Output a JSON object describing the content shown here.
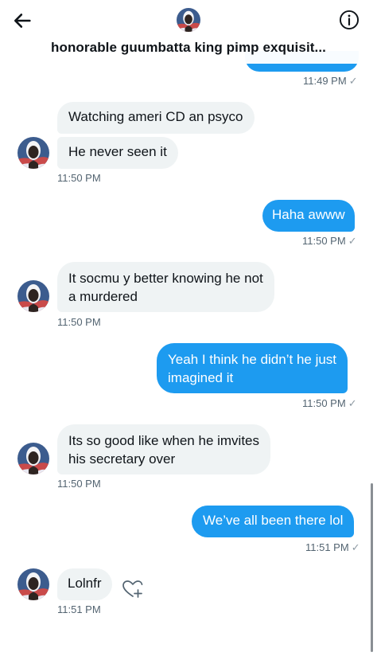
{
  "header": {
    "title": "honorable guumbatta king pimp exquisit...",
    "back_icon": "arrow-left-icon",
    "info_icon": "info-circle-icon"
  },
  "colors": {
    "accent": "#1d9bf0",
    "incoming_bubble": "#eff3f4",
    "timestamp": "#536471"
  },
  "check_mark": "✓",
  "messages": [
    {
      "direction": "outgoing",
      "timestamp": "11:49 PM",
      "seen": true
    },
    {
      "direction": "incoming",
      "lines": [
        "Watching ameri CD an psyco"
      ]
    },
    {
      "direction": "incoming",
      "lines": [
        "He never seen it"
      ],
      "timestamp": "11:50 PM"
    },
    {
      "direction": "outgoing",
      "lines": [
        "Haha awww"
      ],
      "timestamp": "11:50 PM",
      "seen": true
    },
    {
      "direction": "incoming",
      "lines": [
        "It socmu y better knowing he not",
        "a murdered"
      ],
      "timestamp": "11:50 PM"
    },
    {
      "direction": "outgoing",
      "lines": [
        "Yeah I think he didn’t he just",
        "imagined it"
      ],
      "timestamp": "11:50 PM",
      "seen": true
    },
    {
      "direction": "incoming",
      "lines": [
        "Its so good like when he imvites",
        "his secretary over"
      ],
      "timestamp": "11:50 PM"
    },
    {
      "direction": "outgoing",
      "lines": [
        "We’ve all been there lol"
      ],
      "timestamp": "11:51 PM",
      "seen": true
    },
    {
      "direction": "incoming",
      "lines": [
        "Lolnfr"
      ],
      "timestamp": "11:51 PM",
      "reaction_icon": "heart-plus-icon"
    }
  ]
}
